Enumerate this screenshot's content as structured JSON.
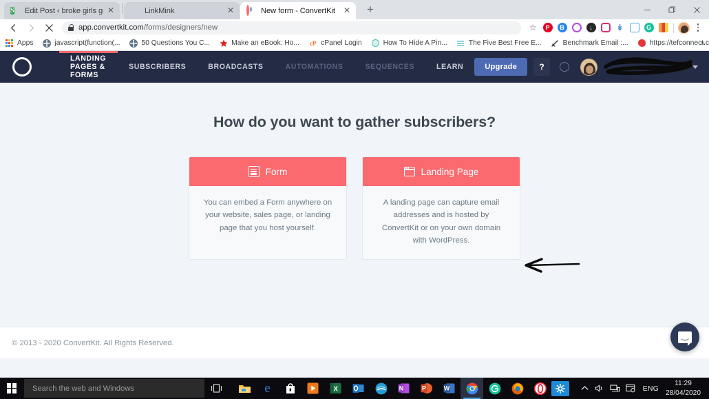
{
  "browser": {
    "tabs": [
      {
        "title": "Edit Post ‹ broke girls get fixed —",
        "favicon": "shopify-s-icon",
        "active": false,
        "close_label": "✕"
      },
      {
        "title": "LinkMink",
        "favicon": "blue-square-icon",
        "active": false,
        "close_label": "✕"
      },
      {
        "title": "New form - ConvertKit",
        "favicon": "convertkit-icon",
        "active": true,
        "close_label": "✕"
      }
    ],
    "new_tab_label": "+",
    "window_controls": {
      "minimize": "minimize-icon",
      "restore": "restore-icon",
      "close": "close-icon"
    },
    "toolbar": {
      "back": "back-arrow-icon",
      "forward": "forward-arrow-icon",
      "stop": "stop-x-icon",
      "lock": "lock-icon",
      "url_host": "app.convertkit.com",
      "url_path": "/forms/designers/new",
      "bookmark_star": "☆",
      "extensions": [
        {
          "name": "pinterest-extension-icon",
          "glyph": "P",
          "color": "#e60023"
        },
        {
          "name": "buffer-extension-icon",
          "glyph": "B",
          "color": "#2c86f2"
        },
        {
          "name": "circle-extension-icon",
          "glyph": "◎",
          "color": "#b44ae0"
        },
        {
          "name": "download-extension-icon",
          "glyph": "↓",
          "color": "#262626"
        },
        {
          "name": "instagram-extension-icon",
          "glyph": "◻",
          "color": "#e1306c"
        },
        {
          "name": "bluearrow-extension-icon",
          "glyph": "↡",
          "color": "#4a90d9"
        },
        {
          "name": "screenshot-extension-icon",
          "glyph": "▣",
          "color": "#3da5d9"
        },
        {
          "name": "grammarly-extension-icon",
          "glyph": "G",
          "color": "#15c39a"
        },
        {
          "name": "colorful-extension-icon",
          "glyph": "▮",
          "color": "#f2a33c"
        }
      ],
      "profile_avatar": "profile-avatar",
      "menu": "chrome-menu-icon"
    },
    "bookmarks": [
      {
        "label": "Apps",
        "icon": "apps-grid-icon"
      },
      {
        "label": "javascript(function(...",
        "icon": "globe-icon"
      },
      {
        "label": "50 Questions You C...",
        "icon": "globe-icon"
      },
      {
        "label": "Make an eBook: Ho...",
        "icon": "star-red-icon"
      },
      {
        "label": "cPanel Login",
        "icon": "cpanel-icon"
      },
      {
        "label": "How To Hide A Pin...",
        "icon": "teal-circle-icon"
      },
      {
        "label": "The Five Best Free E...",
        "icon": "lines-icon"
      },
      {
        "label": "Benchmark Email :...",
        "icon": "rocket-icon"
      },
      {
        "label": "https://tefconnect.c...",
        "icon": "red-blob-icon"
      }
    ],
    "bookmarks_overflow": "»"
  },
  "app": {
    "nav": {
      "logo": "convertkit-logo",
      "items": [
        {
          "label": "LANDING PAGES & FORMS",
          "state": "active"
        },
        {
          "label": "SUBSCRIBERS",
          "state": "normal"
        },
        {
          "label": "BROADCASTS",
          "state": "normal"
        },
        {
          "label": "AUTOMATIONS",
          "state": "muted"
        },
        {
          "label": "SEQUENCES",
          "state": "muted"
        },
        {
          "label": "LEARN",
          "state": "normal"
        }
      ],
      "upgrade_label": "Upgrade",
      "help_label": "?",
      "notifications_icon": "circle-icon",
      "avatar": "user-avatar",
      "username_redacted": "scribbled-out-username",
      "caret": "chevron-down-icon",
      "accent_color": "#fb6970",
      "background_color": "#242b45"
    },
    "main": {
      "headline": "How do you want to gather subscribers?",
      "cards": [
        {
          "title": "Form",
          "icon": "form-icon",
          "description": "You can embed a Form anywhere on your website, sales page, or landing page that you host yourself."
        },
        {
          "title": "Landing Page",
          "icon": "landing-page-icon",
          "description": "A landing page can capture email addresses and is hosted by ConvertKit or on your own domain with WordPress."
        }
      ],
      "card_header_color": "#FA6A6E",
      "annotation": "hand-drawn-left-arrow"
    },
    "footer": {
      "copyright": "© 2013 - 2020 ConvertKit. All Rights Reserved."
    },
    "support_widget": "intercom-chat-bubble"
  },
  "taskbar": {
    "start": "windows-start-icon",
    "search_placeholder": "Search the web and Windows",
    "task_view": "task-view-icon",
    "apps": [
      {
        "name": "file-explorer-icon",
        "glyph": "▤",
        "color": "#f7b43d"
      },
      {
        "name": "edge-icon",
        "glyph": "e",
        "color": "#2e7cd6"
      },
      {
        "name": "microsoft-store-icon",
        "glyph": "▥",
        "color": "#ffffff"
      },
      {
        "name": "media-player-icon",
        "glyph": "▶",
        "color": "#f07a1a"
      },
      {
        "name": "excel-icon",
        "glyph": "X",
        "color": "#1d7044"
      },
      {
        "name": "outlook-icon",
        "glyph": "O",
        "color": "#0f6cbd"
      },
      {
        "name": "skype-icon",
        "glyph": "≈",
        "color": "#1f9ed8"
      },
      {
        "name": "onenote-icon",
        "glyph": "N",
        "color": "#923ec1"
      },
      {
        "name": "powerpoint-icon",
        "glyph": "P",
        "color": "#d24726"
      },
      {
        "name": "word-icon",
        "glyph": "W",
        "color": "#2a5699"
      },
      {
        "name": "chrome-icon",
        "glyph": "◉",
        "color": "#4285f4",
        "active": true
      },
      {
        "name": "grammarly-icon",
        "glyph": "G",
        "color": "#15c39a"
      },
      {
        "name": "firefox-icon",
        "glyph": "◍",
        "color": "#e66000"
      },
      {
        "name": "opera-icon",
        "glyph": "O",
        "color": "#ff1b2d"
      },
      {
        "name": "settings-icon",
        "glyph": "✿",
        "color": "#0078d7"
      }
    ],
    "tray": {
      "chevron": "show-hidden-icons-icon",
      "sound": "sound-icon",
      "network": "network-icon",
      "action_center": "action-center-icon",
      "language": "ENG",
      "time": "11:29",
      "date": "28/04/2020"
    }
  }
}
